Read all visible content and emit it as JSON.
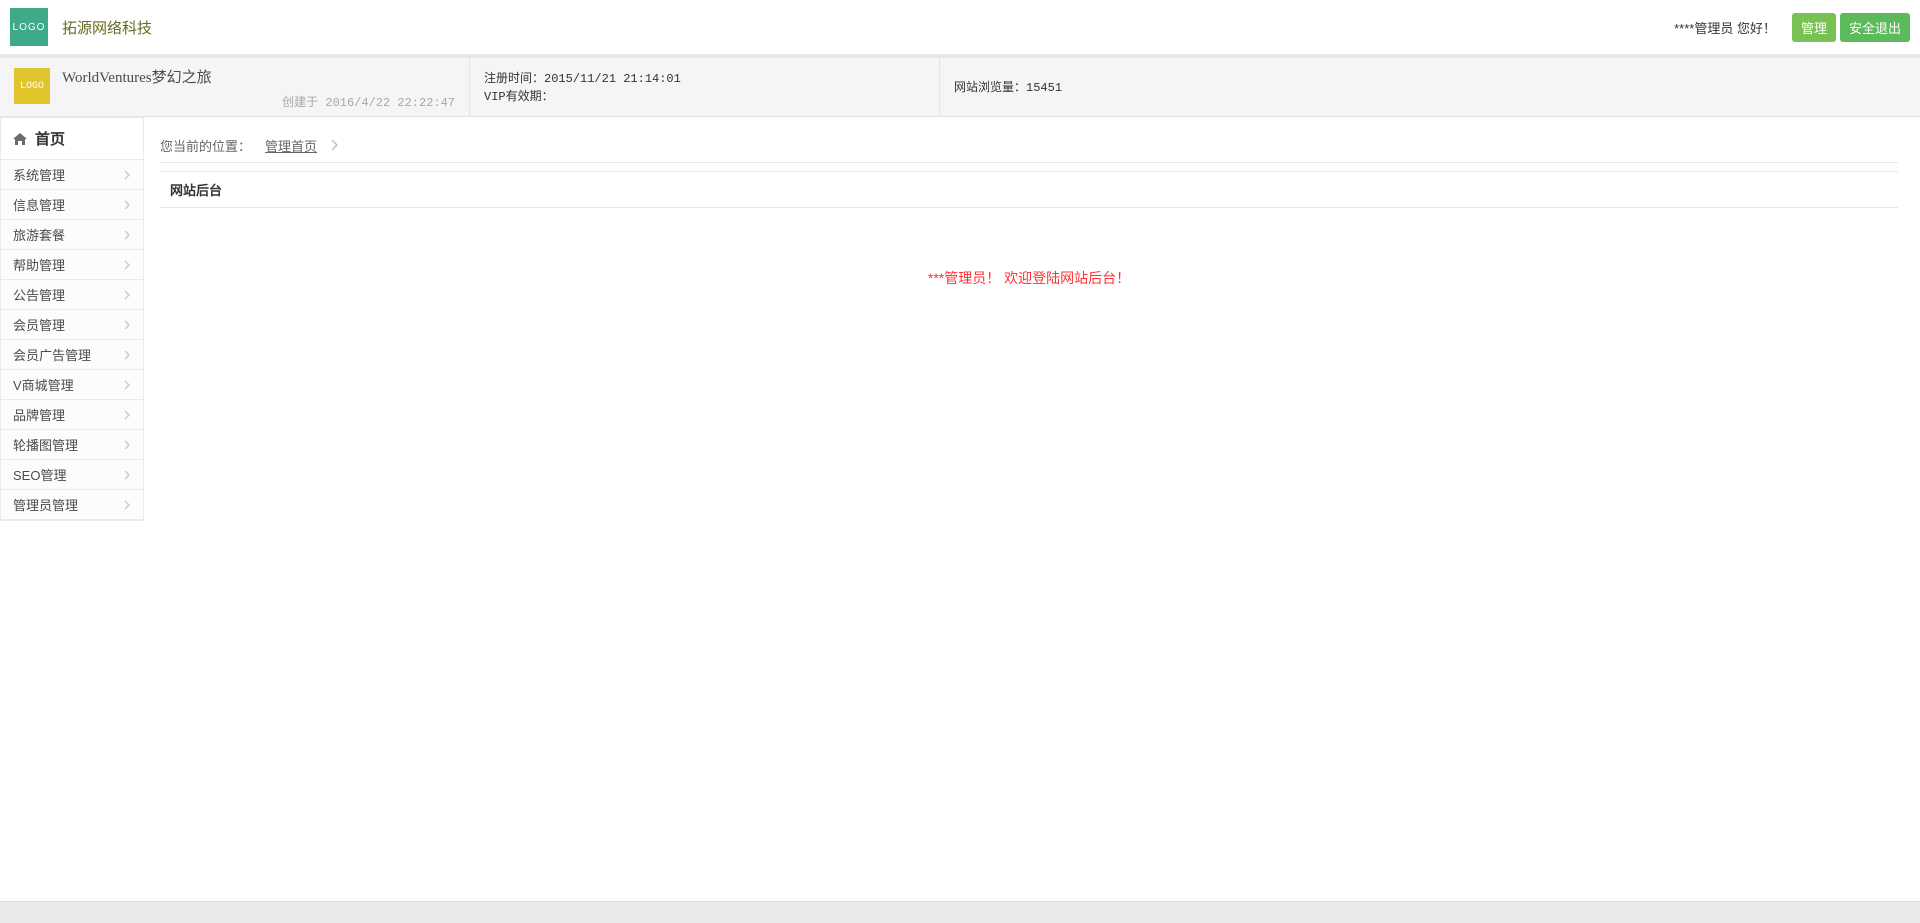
{
  "colors": {
    "logo_green": "#3fa98a",
    "logo_yellow": "#e0c52d",
    "btn_manage": "#78c253",
    "btn_logout": "#5cb95c",
    "welcome_red": "#f33"
  },
  "header": {
    "logo_text": "LOGO",
    "brand": "拓源网络科技",
    "greeting": "****管理员  您好！",
    "manage_btn": "管理",
    "logout_btn": "安全退出"
  },
  "info": {
    "site_logo_text": "LOGO",
    "site_title": "WorldVentures梦幻之旅",
    "created_label": "创建于",
    "created_at": "2016/4/22 22:22:47",
    "register_label": "注册时间：",
    "register_at": "2015/11/21 21:14:01",
    "vip_label": "VIP有效期：",
    "vip_value": "",
    "views_label": "网站浏览量：",
    "views_value": "15451"
  },
  "sidebar": {
    "home": "首页",
    "items": [
      {
        "label": "系统管理"
      },
      {
        "label": "信息管理"
      },
      {
        "label": "旅游套餐"
      },
      {
        "label": "帮助管理"
      },
      {
        "label": "公告管理"
      },
      {
        "label": "会员管理"
      },
      {
        "label": "会员广告管理"
      },
      {
        "label": "V商城管理"
      },
      {
        "label": "品牌管理"
      },
      {
        "label": "轮播图管理"
      },
      {
        "label": "SEO管理"
      },
      {
        "label": "管理员管理"
      }
    ]
  },
  "breadcrumb": {
    "prefix": "您当前的位置：",
    "current": "管理首页"
  },
  "panel": {
    "title": "网站后台",
    "welcome": "***管理员！   欢迎登陆网站后台！"
  }
}
